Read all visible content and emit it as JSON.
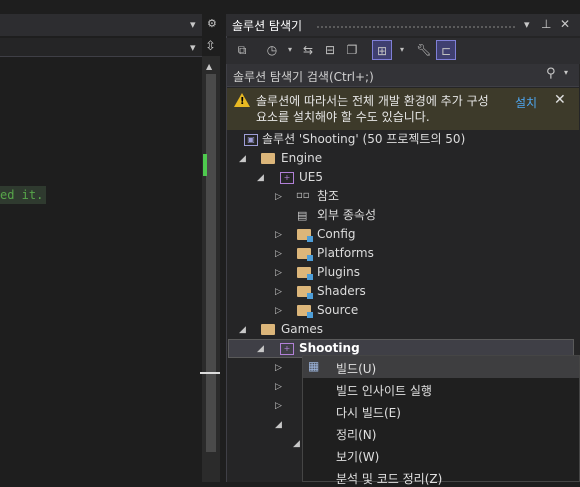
{
  "editor": {
    "code_hint": "ed it.",
    "top_icons": [
      "chevron-down-icon",
      "gear-icon"
    ],
    "header_icons": [
      "chevron-down-icon",
      "split-icon"
    ]
  },
  "explorer": {
    "title": "솔루션 탐색기",
    "search_placeholder": "솔루션 탐색기 검색(Ctrl+;)",
    "title_buttons": [
      "chevron-down-icon",
      "pin-icon",
      "close-icon"
    ],
    "toolbar_icons": [
      "vs-switch-icon",
      "history-icon",
      "sync-icon",
      "collapse-icon",
      "copy-icon",
      "tree-filter-icon",
      "wrench-icon",
      "preview-icon"
    ],
    "warning": {
      "text": "솔루션에 따라서는 전체 개발 환경에 추가 구성 요소를 설치해야 할 수도 있습니다.",
      "install_link": "설치",
      "close": "✕"
    },
    "tree": {
      "solution": "솔루션 'Shooting'  (50 프로젝트의 50)",
      "engine": "Engine",
      "ue5": "UE5",
      "refs": "참조",
      "external": "외부 종속성",
      "config": "Config",
      "platforms": "Platforms",
      "plugins": "Plugins",
      "shaders": "Shaders",
      "source": "Source",
      "games": "Games",
      "shooting": "Shooting"
    }
  },
  "context_menu": {
    "items": [
      "빌드(U)",
      "빌드 인사이트 실행",
      "다시 빌드(E)",
      "정리(N)",
      "보기(W)",
      "분석 및 코드 정리(Z)"
    ]
  },
  "colors": {
    "accent_warning": "#e8b923",
    "link": "#4ea6f0",
    "folder": "#dcb67a",
    "project": "#b180d7"
  }
}
